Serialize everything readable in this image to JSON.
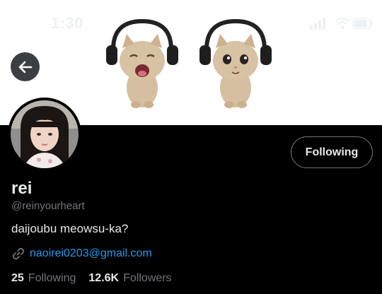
{
  "status_bar": {
    "time": "1:30"
  },
  "profile": {
    "display_name": "rei",
    "handle": "@reinyourheart",
    "bio": "daijoubu meowsu-ka?",
    "link": "naoirei0203@gmail.com",
    "following_button_label": "Following",
    "following_count": "25",
    "following_label": "Following",
    "followers_count": "12.6K",
    "followers_label": "Followers"
  },
  "colors": {
    "background": "#000000",
    "banner": "#ffffff",
    "primary_text": "#e7e9ea",
    "secondary_text": "#71767b",
    "link": "#1d9bf0"
  },
  "icons": {
    "back": "back-arrow-icon",
    "link": "link-icon",
    "signal": "signal-icon",
    "wifi": "wifi-icon",
    "battery": "battery-icon"
  }
}
